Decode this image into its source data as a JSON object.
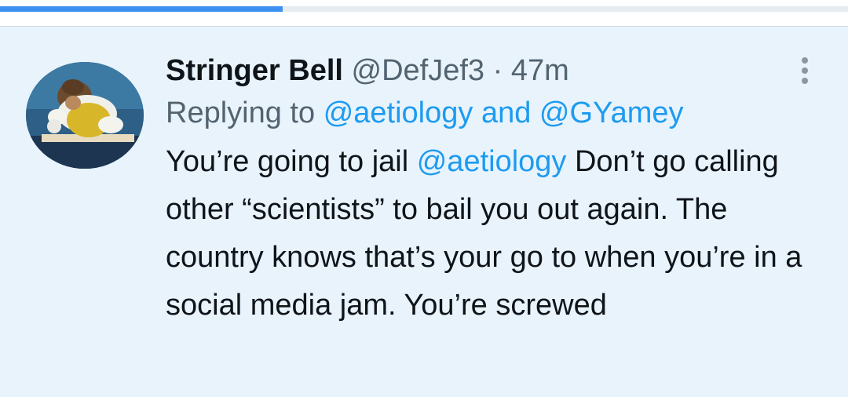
{
  "progress": {
    "fraction": 0.333
  },
  "tweet": {
    "author_name": "Stringer Bell",
    "handle": "@DefJef3",
    "separator": "·",
    "time": "47m",
    "replying_prefix": "Replying to",
    "reply_mention_1": "@aetiology",
    "reply_and": "and",
    "reply_mention_2": "@GYamey",
    "text_part1": "You’re going to jail",
    "text_mention": "@aetiology",
    "text_part2": "Don’t go calling other “scientists” to bail you out again. The country knows that’s your go to when you’re in a social media jam. You’re screwed"
  },
  "icons": {
    "more": "more-vertical-icon",
    "avatar": "profile-avatar"
  },
  "colors": {
    "accent": "#1d9bf0",
    "progress": "#3d8ff0",
    "background": "#e8f3fc",
    "text": "#0f1419",
    "secondary": "#536471"
  }
}
